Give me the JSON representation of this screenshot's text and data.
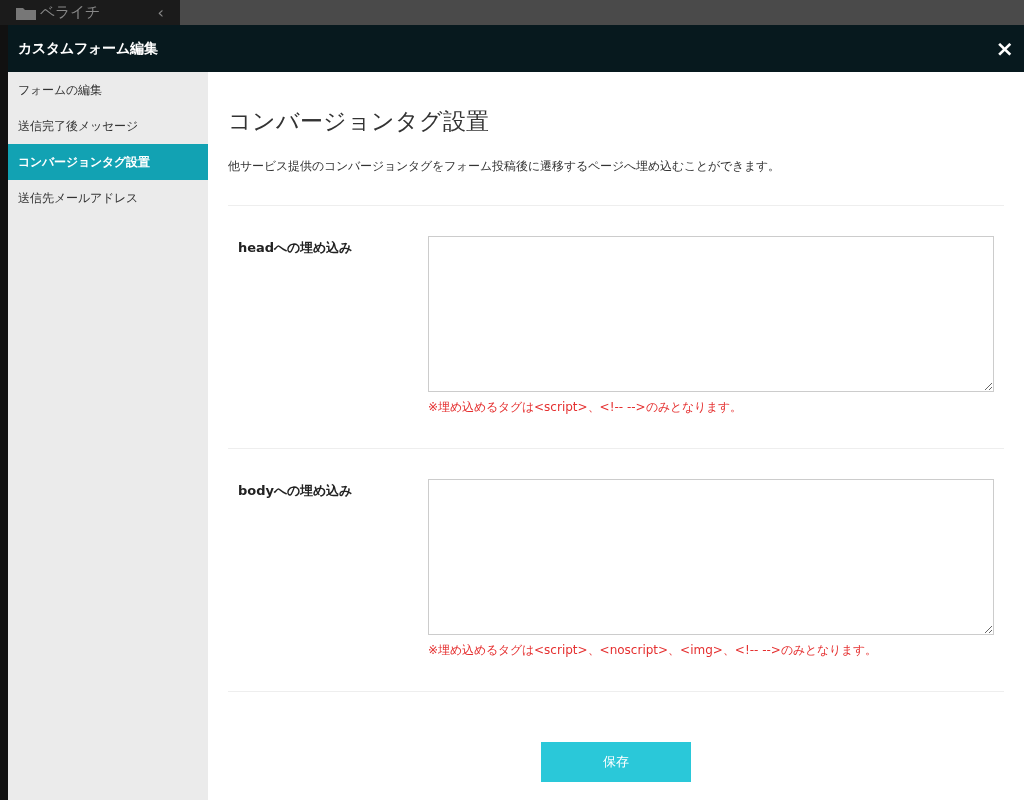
{
  "background_app": {
    "logo": "ベライチ",
    "collapse": "‹"
  },
  "modal": {
    "title": "カスタムフォーム編集",
    "close": "×"
  },
  "sidebar": {
    "items": [
      {
        "label": "フォームの編集",
        "selected": false
      },
      {
        "label": "送信完了後メッセージ",
        "selected": false
      },
      {
        "label": "コンバージョンタグ設置",
        "selected": true
      },
      {
        "label": "送信先メールアドレス",
        "selected": false
      }
    ]
  },
  "content": {
    "heading": "コンバージョンタグ設置",
    "description": "他サービス提供のコンバージョンタグをフォーム投稿後に遷移するページへ埋め込むことができます。",
    "fields": [
      {
        "label": "headへの埋め込み",
        "note": "※埋め込めるタグは<script>、<!-- -->のみとなります。"
      },
      {
        "label": "bodyへの埋め込み",
        "note": "※埋め込めるタグは<script>、<noscript>、<img>、<!-- -->のみとなります。"
      }
    ],
    "save_button": "保存"
  }
}
